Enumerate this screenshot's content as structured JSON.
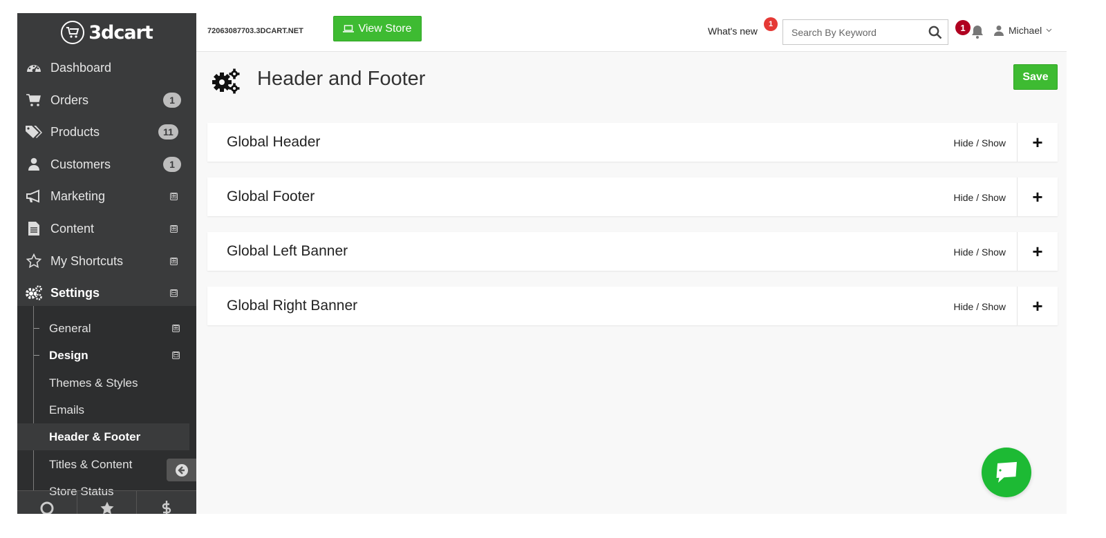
{
  "brand": {
    "logo_text": "3dcart"
  },
  "topbar": {
    "store_url": "72063087703.3DCART.NET",
    "view_store_label": "View Store",
    "whats_new_label": "What's new",
    "whats_new_badge": "1",
    "search_placeholder": "Search By Keyword",
    "notifications_badge": "1",
    "user_name": "Michael"
  },
  "sidebar": {
    "items": [
      {
        "label": "Dashboard",
        "icon": "dashboard-icon"
      },
      {
        "label": "Orders",
        "icon": "cart-icon",
        "badge": "1"
      },
      {
        "label": "Products",
        "icon": "tags-icon",
        "badge": "11"
      },
      {
        "label": "Customers",
        "icon": "user-icon",
        "badge": "1"
      },
      {
        "label": "Marketing",
        "icon": "megaphone-icon",
        "expander": "⊞"
      },
      {
        "label": "Content",
        "icon": "document-icon",
        "expander": "⊞"
      },
      {
        "label": "My Shortcuts",
        "icon": "star-icon",
        "expander": "⊞"
      },
      {
        "label": "Settings",
        "icon": "gears-icon",
        "expander": "⊟"
      }
    ],
    "submenu": [
      {
        "label": "General",
        "expander": "⊞"
      },
      {
        "label": "Design",
        "expander": "⊟"
      },
      {
        "label": "Themes & Styles"
      },
      {
        "label": "Emails"
      },
      {
        "label": "Header & Footer"
      },
      {
        "label": "Titles & Content"
      },
      {
        "label": "Store Status"
      }
    ]
  },
  "main": {
    "page_title": "Header and Footer",
    "save_label": "Save",
    "panels": [
      {
        "title": "Global Header",
        "toggle": "Hide / Show",
        "expand": "+"
      },
      {
        "title": "Global Footer",
        "toggle": "Hide / Show",
        "expand": "+"
      },
      {
        "title": "Global Left Banner",
        "toggle": "Hide / Show",
        "expand": "+"
      },
      {
        "title": "Global Right Banner",
        "toggle": "Hide / Show",
        "expand": "+"
      }
    ]
  },
  "colors": {
    "sidebar_bg": "#3a3b3c",
    "accent_green": "#3ebb32",
    "badge_red": "#e53935",
    "alert_red": "#b00020",
    "chat_green": "#1dba34"
  }
}
